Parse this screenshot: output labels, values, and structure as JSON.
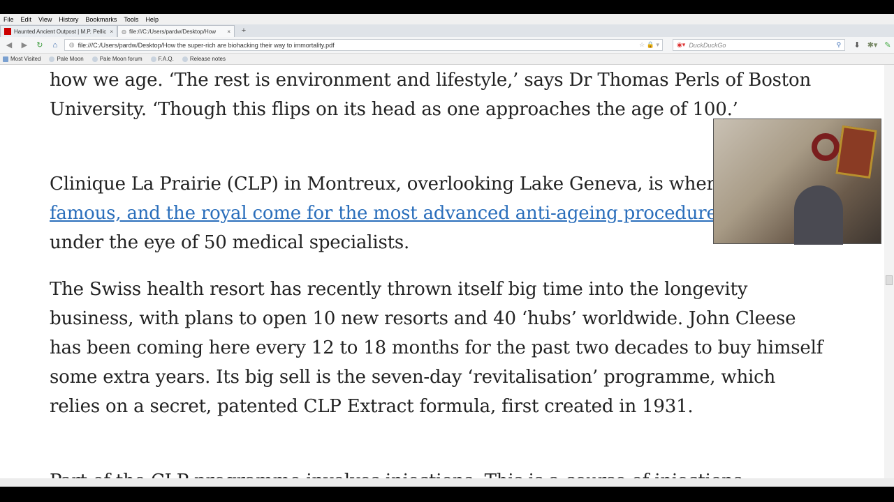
{
  "menu": [
    "File",
    "Edit",
    "View",
    "History",
    "Bookmarks",
    "Tools",
    "Help"
  ],
  "tabs": [
    {
      "label": "Haunted Ancient Outpost | M.P. Pellic"
    },
    {
      "label": "file:///C:/Users/pardw/Desktop/How"
    }
  ],
  "url": "file:///C:/Users/pardw/Desktop/How the super-rich are biohacking their way to immortality.pdf",
  "search_placeholder": "DuckDuckGo",
  "bookmarks": [
    "Most Visited",
    "Pale Moon",
    "Pale Moon forum",
    "F.A.Q.",
    "Release notes"
  ],
  "article": {
    "p1": "how we age. ‘The rest is environment and lifestyle,’ says Dr Thomas Perls of Boston University. ‘Though this flips on its head as one approaches the age of 100.’",
    "p2_pre": "Clinique La Prairie (CLP) in Montreux, overlooking Lake Geneva, is where the ",
    "p2_link": "rich, the famous, and the royal come for the most advanced anti-ageing procedures",
    "p2_post": " in Europe under the eye of 50 medical specialists.",
    "p3": "The Swiss health resort has recently thrown itself big time into the longevity business, with plans to open 10 new resorts and 40 ‘hubs’ worldwide. John Cleese has been coming here every 12 to 18 months for the past two decades to buy himself some extra years. Its big sell is the seven-day ‘revitalisation’ programme, which relies on a secret, patented CLP Extract formula, first created in 1931.",
    "p4": "Part of the CLP programme involves injections. This is a course of injections"
  }
}
